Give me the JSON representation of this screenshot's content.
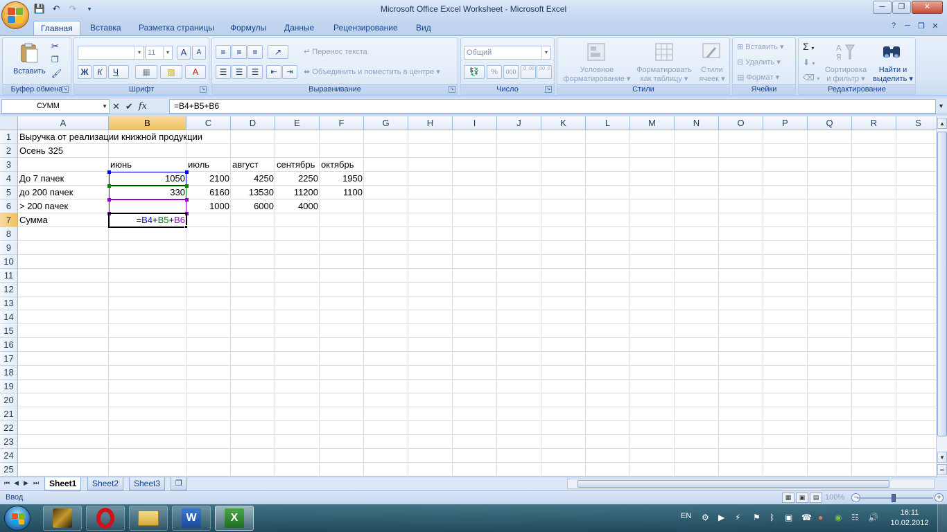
{
  "window": {
    "title": "Microsoft Office Excel Worksheet - Microsoft Excel"
  },
  "qat": {
    "save_icon": "save-icon",
    "undo_icon": "undo-icon",
    "redo_icon": "redo-icon",
    "customize_icon": "chevron-down-icon"
  },
  "window_controls": {
    "minimize": "─",
    "maximize": "❐",
    "close": "✕"
  },
  "tabs": [
    {
      "label": "Главная",
      "active": true
    },
    {
      "label": "Вставка"
    },
    {
      "label": "Разметка страницы"
    },
    {
      "label": "Формулы"
    },
    {
      "label": "Данные"
    },
    {
      "label": "Рецензирование"
    },
    {
      "label": "Вид"
    }
  ],
  "ribbon": {
    "clipboard": {
      "label": "Буфер обмена",
      "paste": "Вставить"
    },
    "font": {
      "label": "Шрифт",
      "font_name": "",
      "font_size": "11",
      "bold": "Ж",
      "italic": "К",
      "underline": "Ч",
      "grow": "A",
      "shrink": "A"
    },
    "alignment": {
      "label": "Выравнивание",
      "wrap_text": "Перенос текста",
      "merge_center": "Объединить и поместить в центре"
    },
    "number": {
      "label": "Число",
      "format": "Общий",
      "percent": "%",
      "thousands": "000",
      "inc_decimal": ",0 ,00",
      "dec_decimal": ",00 ,0"
    },
    "styles": {
      "label": "Стили",
      "conditional_1": "Условное",
      "conditional_2": "форматирование",
      "as_table_1": "Форматировать",
      "as_table_2": "как таблицу",
      "cell_styles_1": "Стили",
      "cell_styles_2": "ячеек"
    },
    "cells": {
      "label": "Ячейки",
      "insert": "Вставить",
      "delete": "Удалить",
      "format": "Формат"
    },
    "editing": {
      "label": "Редактирование",
      "sort_1": "Сортировка",
      "sort_2": "и фильтр",
      "find_1": "Найти и",
      "find_2": "выделить"
    }
  },
  "formula_bar": {
    "name_box": "СУММ",
    "cancel": "✕",
    "enter": "✔",
    "fx": "fx",
    "formula": "=B4+B5+B6"
  },
  "columns": [
    "A",
    "B",
    "C",
    "D",
    "E",
    "F",
    "G",
    "H",
    "I",
    "J",
    "K",
    "L",
    "M",
    "N",
    "O",
    "P",
    "Q",
    "R",
    "S"
  ],
  "rows": [
    "1",
    "2",
    "3",
    "4",
    "5",
    "6",
    "7",
    "8",
    "9",
    "10",
    "11",
    "12",
    "13",
    "14",
    "15",
    "16",
    "17",
    "18",
    "19",
    "20",
    "21",
    "22",
    "23",
    "24",
    "25"
  ],
  "cells": {
    "A1": "Выручка от реализации книжной продукции",
    "A2": "Осень 325",
    "B3": "июнь",
    "C3": "июль",
    "D3": "август",
    "E3": "сентябрь",
    "F3": "октябрь",
    "A4": "До 7 пачек",
    "B4": "1050",
    "C4": "2100",
    "D4": "4250",
    "E4": "2250",
    "F4": "1950",
    "A5": "до 200 пачек",
    "B5": "330",
    "C5": "6160",
    "D5": "13530",
    "E5": "11200",
    "F5": "1100",
    "A6": "> 200 пачек",
    "C6": "1000",
    "D6": "6000",
    "E6": "4000",
    "A7": "Сумма",
    "B7": {
      "eq": "=",
      "r1": "B4",
      "p1": "+",
      "r2": "B5",
      "p2": "+",
      "r3": "B6"
    }
  },
  "ref_colors": {
    "r1": "#0000ff",
    "r2": "#008000",
    "r3": "#9900cc"
  },
  "sheets": [
    {
      "label": "Sheet1",
      "active": true
    },
    {
      "label": "Sheet2"
    },
    {
      "label": "Sheet3"
    }
  ],
  "status": {
    "mode": "Ввод",
    "zoom": "100%"
  },
  "taskbar": {
    "lang": "EN",
    "time": "16:11",
    "date": "10.02.2012"
  }
}
